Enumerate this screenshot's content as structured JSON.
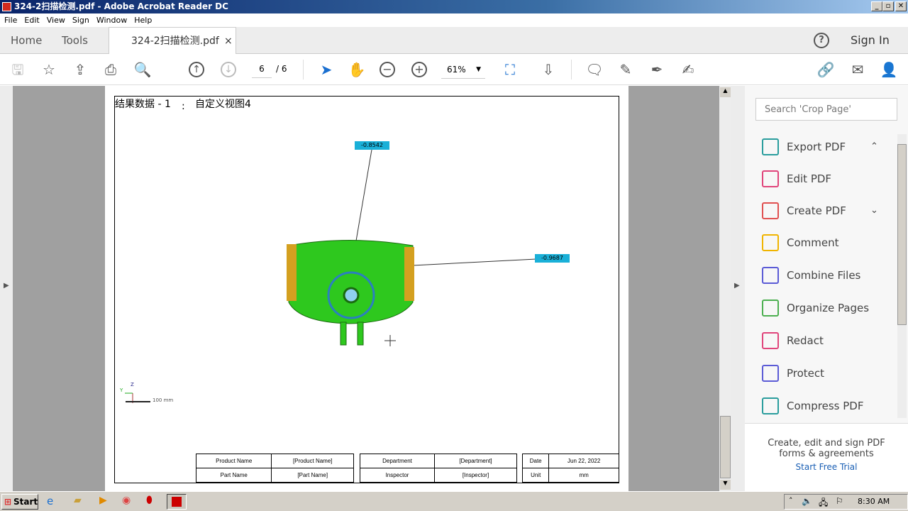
{
  "window": {
    "title": "324-2扫描检测.pdf - Adobe Acrobat Reader DC",
    "min": "_",
    "max": "▫",
    "close": "✕"
  },
  "menu": [
    "File",
    "Edit",
    "View",
    "Sign",
    "Window",
    "Help"
  ],
  "tabs": {
    "home": "Home",
    "tools": "Tools",
    "doc": "324-2扫描检测.pdf",
    "close": "×",
    "help": "?",
    "signin": "Sign In"
  },
  "toolbar": {
    "page_current": "6",
    "page_total": "/ 6",
    "zoom": "61%"
  },
  "document": {
    "heading_left": "结果数据 - 1",
    "heading_sep": ":",
    "heading_right": "自定义视图4",
    "labels": [
      "-0.8542",
      "-0.9687"
    ],
    "axis": {
      "z": "Z",
      "y": "Y",
      "scale": "100 mm"
    },
    "table": [
      [
        "Product Name",
        "[Product Name]",
        "Department",
        "[Department]",
        "Date",
        "Jun 22, 2022"
      ],
      [
        "Part Name",
        "[Part Name]",
        "Inspector",
        "[Inspector]",
        "Unit",
        "mm"
      ]
    ],
    "label_color": "#1ab0d8",
    "part_color": "#2ec81e"
  },
  "right_pane": {
    "search_placeholder": "Search 'Crop Page'",
    "tools": [
      {
        "label": "Export PDF",
        "icon": "export-pdf-icon",
        "color": "#2a9d9d"
      },
      {
        "label": "Edit PDF",
        "icon": "edit-pdf-icon",
        "color": "#e0457b"
      },
      {
        "label": "Create PDF",
        "icon": "create-pdf-icon",
        "color": "#e05050"
      },
      {
        "label": "Comment",
        "icon": "comment-icon",
        "color": "#f0b400"
      },
      {
        "label": "Combine Files",
        "icon": "combine-files-icon",
        "color": "#5b5bd6"
      },
      {
        "label": "Organize Pages",
        "icon": "organize-pages-icon",
        "color": "#4caf50"
      },
      {
        "label": "Redact",
        "icon": "redact-icon",
        "color": "#e0457b"
      },
      {
        "label": "Protect",
        "icon": "protect-icon",
        "color": "#5b5bd6"
      },
      {
        "label": "Compress PDF",
        "icon": "compress-pdf-icon",
        "color": "#2a9d9d"
      }
    ],
    "promo": "Create, edit and sign PDF forms & agreements",
    "trial": "Start Free Trial"
  },
  "taskbar": {
    "start": "Start",
    "time": "8:30 AM"
  }
}
